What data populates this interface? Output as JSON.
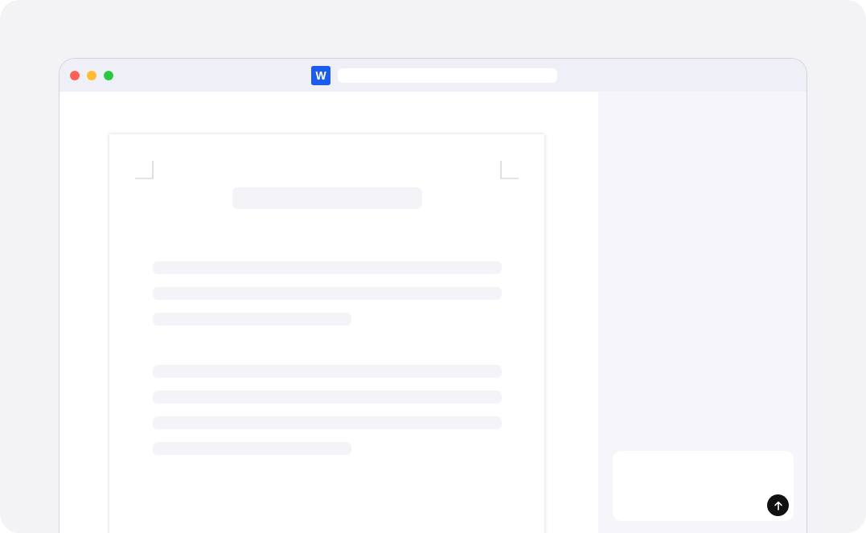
{
  "window": {
    "app_icon": {
      "letter": "W"
    }
  }
}
